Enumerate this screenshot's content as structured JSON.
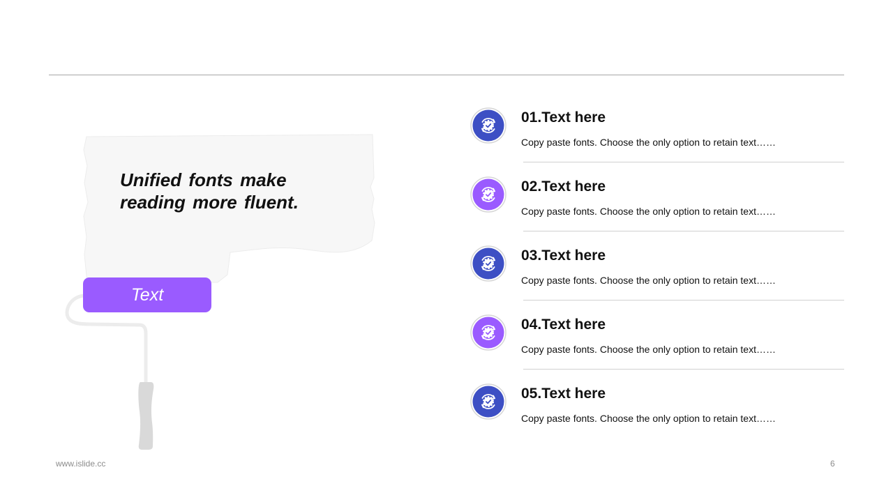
{
  "quote": {
    "line1": "Unified fonts make",
    "line2": "reading more fluent."
  },
  "roller": {
    "label": "Text"
  },
  "items": [
    {
      "title": "01.Text here",
      "desc": "Copy paste fonts. Choose the only option to retain text……",
      "icon": "refresh-gear-icon",
      "color": "#3d4fc4"
    },
    {
      "title": "02.Text here",
      "desc": "Copy paste fonts. Choose the only option to retain text……",
      "icon": "refresh-gear-icon",
      "color": "#9a5bff"
    },
    {
      "title": "03.Text here",
      "desc": "Copy paste fonts. Choose the only option to retain text……",
      "icon": "refresh-gear-icon",
      "color": "#3d4fc4"
    },
    {
      "title": "04.Text here",
      "desc": "Copy paste fonts. Choose the only option to retain text……",
      "icon": "refresh-gear-icon",
      "color": "#9a5bff"
    },
    {
      "title": "05.Text here",
      "desc": "Copy paste fonts. Choose the only option to retain text……",
      "icon": "refresh-gear-icon",
      "color": "#3d4fc4"
    }
  ],
  "footer": {
    "url": "www.islide.cc",
    "page": "6"
  }
}
